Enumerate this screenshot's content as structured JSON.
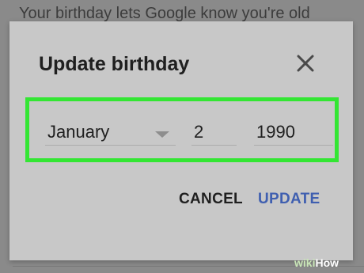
{
  "background": {
    "text": "Your birthday lets Google know you're old"
  },
  "dialog": {
    "title": "Update birthday",
    "close_icon": "close-icon",
    "month": {
      "value": "January",
      "icon": "dropdown-arrow-icon"
    },
    "day": {
      "value": "2"
    },
    "year": {
      "value": "1990"
    },
    "cancel_label": "CANCEL",
    "update_label": "UPDATE"
  },
  "watermark": {
    "prefix": "wiki",
    "suffix": "How"
  },
  "colors": {
    "highlight": "#33e633",
    "accent": "#3f5fb0",
    "dialog_bg": "#c8c8c8",
    "scrim": "#8a8a8a"
  }
}
